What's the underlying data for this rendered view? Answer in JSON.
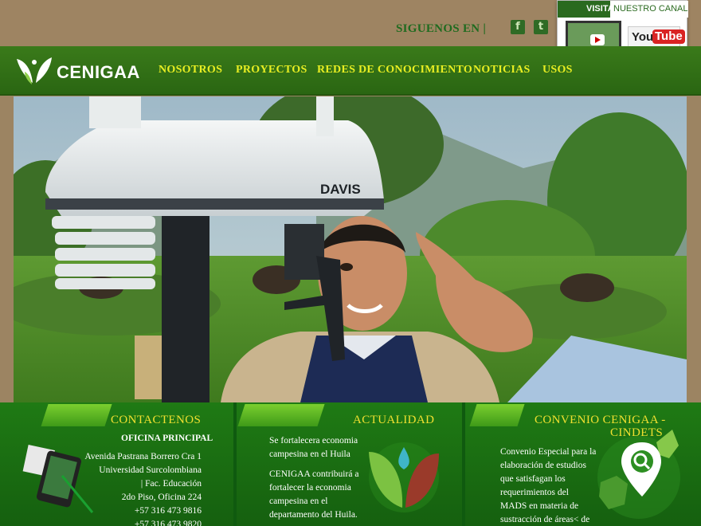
{
  "header": {
    "follow_label": "SIGUENOS EN |",
    "social": [
      {
        "icon": "facebook-icon",
        "glyph": "f"
      },
      {
        "icon": "twitter-icon",
        "glyph": "t"
      }
    ],
    "youtube_promo": {
      "visita": "VISITA",
      "canal": "NUESTRO CANAL",
      "you": "You",
      "tube": "Tube"
    }
  },
  "nav": {
    "logo_text": "CENIGAA",
    "items": [
      "NOSOTROS",
      "PROYECTOS",
      "REDES DE CONOCIMIENTO",
      "NOTICIAS",
      "USOS"
    ]
  },
  "hero": {
    "brand_on_device": "DAVIS"
  },
  "panels": {
    "contact": {
      "title": "CONTACTENOS",
      "subtitle": "OFICINA PRINCIPAL",
      "lines": [
        "Avenida Pastrana Borrero Cra 1",
        "Universidad Surcolombiana",
        "| Fac. Educación",
        "2do Piso, Oficina 224",
        "+57 316 473 9816",
        "+57 316 473 9820"
      ]
    },
    "news": {
      "title": "ACTUALIDAD",
      "headline_lines": [
        "Se fortalecera economia",
        "campesina en el Huila"
      ],
      "body_lines": [
        "CENIGAA contribuirá a",
        "fortalecer la economia",
        "campesina en el",
        "departamento del Huila."
      ]
    },
    "agreement": {
      "title_lines": [
        "CONVENIO CENIGAA -",
        "CINDETS"
      ],
      "body_lines": [
        "Convenio Especial para la",
        "elaboración de estudios",
        "que satisfagan los",
        "requerimientos del",
        "MADS en materia de",
        "sustracción de áreas< de"
      ]
    }
  },
  "colors": {
    "nav_text": "#e8ee22",
    "panel_title": "#f0e030",
    "nav_bg": "#2f6f16",
    "top_band": "#9e8462"
  }
}
